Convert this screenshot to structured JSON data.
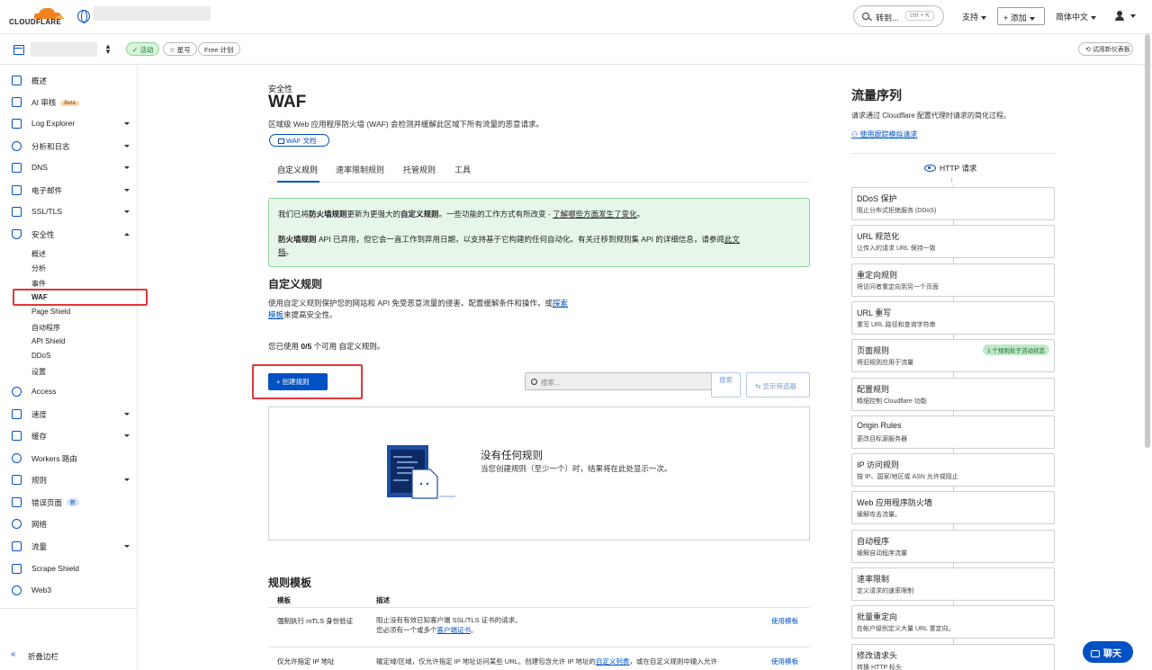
{
  "topbar": {
    "logo_text": "CLOUDFLARE",
    "goto_label": "转到...",
    "goto_shortcut": "ctrl + K",
    "support": "支持",
    "add": "+ 添加",
    "language": "简体中文"
  },
  "subbar": {
    "status": "✓ 活动",
    "star": "☆ 星号",
    "plan": "Free 计划",
    "new_dashboard": "试用新仪表板"
  },
  "sidebar": {
    "items": [
      {
        "label": "概述"
      },
      {
        "label": "AI 审核",
        "badge": "Beta"
      },
      {
        "label": "Log Explorer"
      },
      {
        "label": "分析和日志"
      },
      {
        "label": "DNS"
      },
      {
        "label": "电子邮件"
      },
      {
        "label": "SSL/TLS"
      },
      {
        "label": "安全性"
      },
      {
        "label": "Access"
      },
      {
        "label": "速度"
      },
      {
        "label": "缓存"
      },
      {
        "label": "Workers 路由"
      },
      {
        "label": "规则"
      },
      {
        "label": "错误页面",
        "badge": "新"
      },
      {
        "label": "网络"
      },
      {
        "label": "流量"
      },
      {
        "label": "Scrape Shield"
      },
      {
        "label": "Web3"
      }
    ],
    "security_sub": [
      "概述",
      "分析",
      "事件",
      "WAF",
      "Page Shield",
      "自动程序",
      "API Shield",
      "DDoS",
      "设置"
    ],
    "collapse": "折叠边栏"
  },
  "main": {
    "eyebrow": "安全性",
    "title": "WAF",
    "desc": "区域级 Web 应用程序防火墙 (WAF) 会检测并缓解此区域下所有流量的恶意请求。",
    "doc_button": "WAF 文档",
    "tabs": [
      "自定义规则",
      "速率限制规则",
      "托管规则",
      "工具"
    ],
    "notice": {
      "l1_a": "我们已将",
      "l1_b": "防火墙规则",
      "l1_c": "更新为更强大的",
      "l1_d": "自定义规则",
      "l1_e": "。一些功能的工作方式有所改变 - ",
      "l1_link": "了解哪些方面发生了变化",
      "l1_end": "。",
      "l2_b": "防火墙规则",
      "l2_a": " API 已弃用，但它会一直工作到弃用日期，以支持基于它构建的任何自动化。有关迁移到规则集 API 的详细信息，请参阅",
      "l2_link": "此文",
      "l3_link": "档",
      "l3_end": "。"
    },
    "section_title": "自定义规则",
    "section_desc_a": "使用自定义规则保护您的网站和 API 免受恶意流量的侵害。配置缓解条件和操作，或",
    "section_desc_link1": "探索",
    "section_desc_link2": "模板",
    "section_desc_b": "来提高安全性。",
    "usage_a": "您已使用 ",
    "usage_b": "0/5",
    "usage_c": " 个可用 自定义规则。",
    "create_button": "+ 创建规则",
    "search_placeholder": "搜索...",
    "search_button": "搜索",
    "filter_button": "显示筛选器",
    "empty_title": "没有任何规则",
    "empty_desc": "当您创建规则（至少一个）时，结果将在此处显示一次。",
    "templates_title": "规则模板",
    "templates_headers": [
      "模板",
      "描述"
    ],
    "templates": [
      {
        "name": "强制执行 mTLS 身份验证",
        "desc1": "阻止没有有效已知客户端 SSL/TLS 证书的请求。",
        "desc2_a": "您必须有一个或多个",
        "desc2_link": "客户端证书",
        "desc2_b": "。",
        "use": "使用模板"
      },
      {
        "name": "仅允许指定 IP 地址",
        "desc1_a": "输定域/区域，仅允许指定 IP 地址访问某些 URL。创建包含允许 IP 地址的",
        "desc1_link": "自定义列表",
        "desc1_b": "，或在自定义规则中输入允许",
        "use": "使用模板"
      }
    ]
  },
  "sequence": {
    "title": "流量序列",
    "desc": "请求通过 Cloudflare 配置代理时请求的简化过程。",
    "link": "使用跟踪模拟请求",
    "http": "HTTP 请求",
    "steps": [
      {
        "name": "DDoS 保护",
        "desc": "阻止分布式拒绝服务 (DDoS)"
      },
      {
        "name": "URL 规范化",
        "desc": "让传入的请求 URL 保持一致"
      },
      {
        "name": "重定向规则",
        "desc": "将访问者重定向到另一个页面"
      },
      {
        "name": "URL 重写",
        "desc": "重写 URL 路径和查询字符串"
      },
      {
        "name": "页面规则",
        "desc": "将旧规则应用于流量",
        "active": "1 个规则处于活动状态"
      },
      {
        "name": "配置规则",
        "desc": "精细控制 Cloudflare 功能"
      },
      {
        "name": "Origin Rules",
        "desc": "更改目标源服务器"
      },
      {
        "name": "IP 访问规则",
        "desc": "按 IP、国家/地区或 ASN 允许或阻止"
      },
      {
        "name": "Web 应用程序防火墙",
        "desc": "缓解攻击流量。"
      },
      {
        "name": "自动程序",
        "desc": "缓解自动程序流量"
      },
      {
        "name": "速率限制",
        "desc": "定义请求的速率限制"
      },
      {
        "name": "批量重定向",
        "desc": "在帐户级别定义大量 URL 重定向。"
      },
      {
        "name": "修改请求头",
        "desc": "转换 HTTP 标头"
      }
    ]
  },
  "chat": "聊天",
  "colors": {
    "accent": "#0051c3",
    "brand_orange": "#f38020",
    "highlight_red": "#e0373a",
    "notice_bg": "#e6f7e9"
  }
}
